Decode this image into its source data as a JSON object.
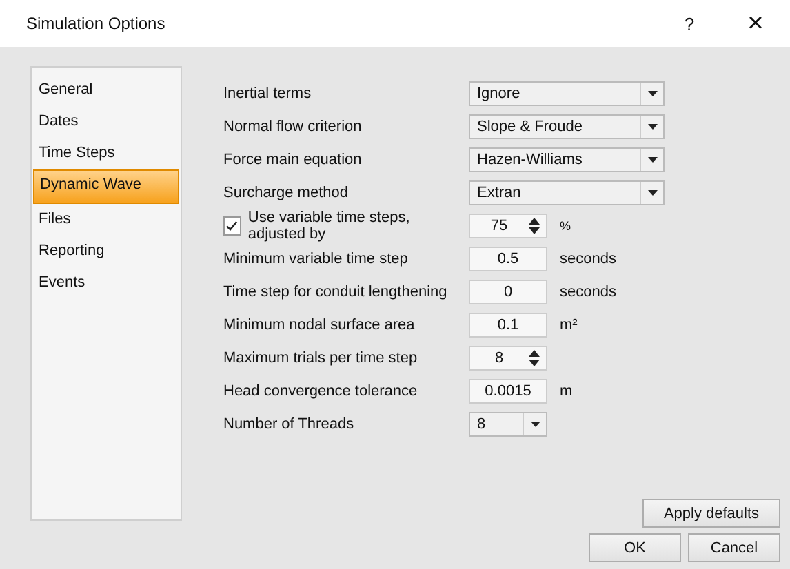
{
  "window": {
    "title": "Simulation Options",
    "help": "?",
    "close": "×"
  },
  "sidebar": {
    "items": [
      {
        "label": "General",
        "selected": false
      },
      {
        "label": "Dates",
        "selected": false
      },
      {
        "label": "Time Steps",
        "selected": false
      },
      {
        "label": "Dynamic Wave",
        "selected": true
      },
      {
        "label": "Files",
        "selected": false
      },
      {
        "label": "Reporting",
        "selected": false
      },
      {
        "label": "Events",
        "selected": false
      }
    ]
  },
  "fields": [
    {
      "kind": "dropdown",
      "label": "Inertial terms",
      "value": "Ignore"
    },
    {
      "kind": "dropdown",
      "label": "Normal flow criterion",
      "value": "Slope & Froude"
    },
    {
      "kind": "dropdown",
      "label": "Force main equation",
      "value": "Hazen-Williams"
    },
    {
      "kind": "dropdown",
      "label": "Surcharge method",
      "value": "Extran"
    },
    {
      "kind": "checkspin",
      "label": "Use variable time steps, adjusted by",
      "checked": true,
      "value": "75",
      "unit": "%"
    },
    {
      "kind": "number",
      "label": "Minimum variable time step",
      "value": "0.5",
      "unit": "seconds"
    },
    {
      "kind": "number",
      "label": "Time step for conduit lengthening",
      "value": "0",
      "unit": "seconds"
    },
    {
      "kind": "number",
      "label": "Minimum nodal surface area",
      "value": "0.1",
      "unit": "m²"
    },
    {
      "kind": "spin",
      "label": "Maximum trials per time step",
      "value": "8"
    },
    {
      "kind": "number",
      "label": "Head convergence tolerance",
      "value": "0.0015",
      "unit": "m"
    },
    {
      "kind": "smalldropdown",
      "label": "Number of Threads",
      "value": "8"
    }
  ],
  "buttons": {
    "apply_defaults": "Apply defaults",
    "ok": "OK",
    "cancel": "Cancel"
  }
}
